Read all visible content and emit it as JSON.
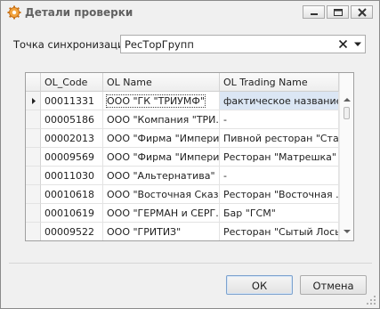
{
  "window": {
    "title": "Детали проверки"
  },
  "sync": {
    "label": "Точка синхронизации:",
    "value": "РесТорГрупп"
  },
  "grid": {
    "columns": [
      "OL_Code",
      "OL Name",
      "OL Trading Name"
    ],
    "rows": [
      {
        "code": "00011331",
        "name": "ООО \"ГК \"ТРИУМФ\"",
        "trading": "фактическое название",
        "selected": true
      },
      {
        "code": "00005186",
        "name": "ООО \"Компания \"ТРИ...",
        "trading": "-"
      },
      {
        "code": "00002013",
        "name": "ООО \"Фирма \"Империал\"",
        "trading": "Пивной ресторан \"Ста..."
      },
      {
        "code": "00009569",
        "name": "ООО \"Фирма \"Империал\"",
        "trading": "Ресторан \"Матрешка\""
      },
      {
        "code": "00011030",
        "name": "ООО \"Альтернатива\"",
        "trading": "-"
      },
      {
        "code": "00010618",
        "name": "ООО \"Восточная Сказ...",
        "trading": "Ресторан \"Восточная ..."
      },
      {
        "code": "00010619",
        "name": "ООО \"ГЕРМАН и СЕРГ...",
        "trading": "Бар \"ГСМ\""
      },
      {
        "code": "00009522",
        "name": "ООО \"ГРИТИЗ\"",
        "trading": "Ресторан \"Сытый Лось\""
      }
    ]
  },
  "buttons": {
    "ok": "ОК",
    "cancel": "Отмена"
  },
  "colors": {
    "selected_cell": "#dbe6f4",
    "accent_icon": "#e8912f"
  }
}
